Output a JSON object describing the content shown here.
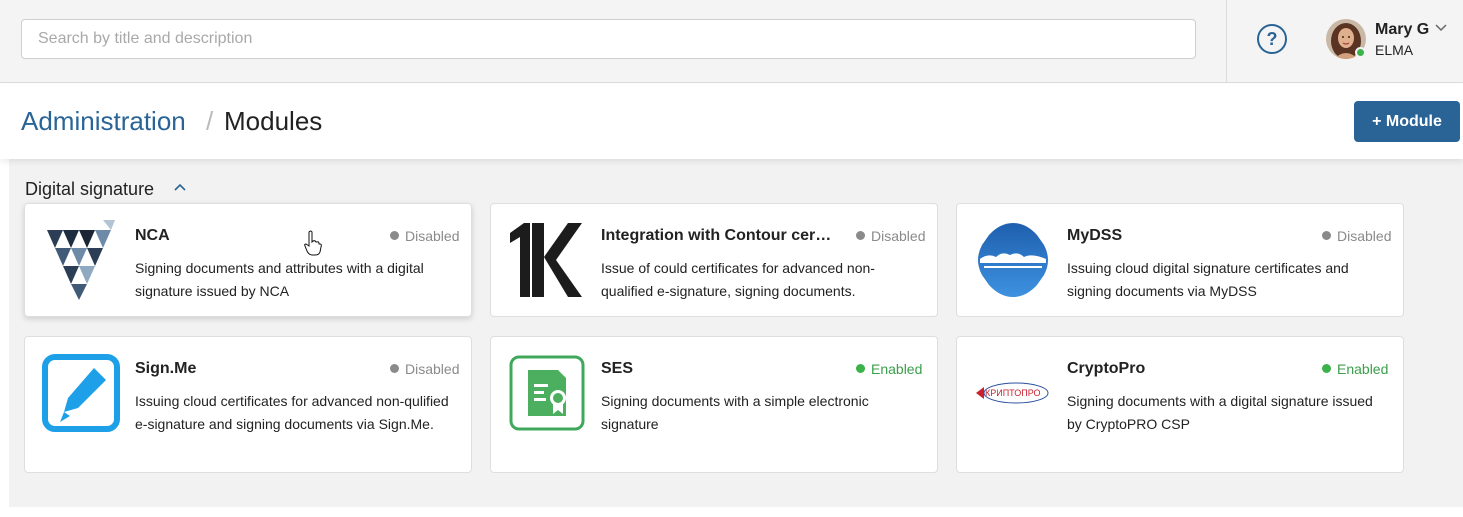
{
  "search": {
    "placeholder": "Search by title and description",
    "value": ""
  },
  "header_icons": {
    "help": "help-question-icon"
  },
  "user": {
    "name": "Mary G",
    "org": "ELMA",
    "online_status": "online"
  },
  "breadcrumb": {
    "parent": "Administration",
    "separator": "/",
    "current": "Modules"
  },
  "add_module_label": "+ Module",
  "section": {
    "title": "Digital signature",
    "expanded": true
  },
  "colors": {
    "accent": "#2a6496",
    "enabled": "#3cb24a",
    "disabled": "#8a8a8a"
  },
  "modules": [
    {
      "title": "NCA",
      "status": "Disabled",
      "state": "disabled",
      "description": "Signing documents and attributes with a digital signature issued by NCA",
      "icon": "nca-logo"
    },
    {
      "title": "Integration with Contour certificates",
      "status": "Disabled",
      "state": "disabled",
      "description": "Issue of could certificates for advanced non-qualified e-signature, signing documents.",
      "icon": "contour-k-logo"
    },
    {
      "title": "MyDSS",
      "status": "Disabled",
      "state": "disabled",
      "description": "Issuing cloud digital signature certificates and signing documents via MyDSS",
      "icon": "mydss-cloud-logo"
    },
    {
      "title": "Sign.Me",
      "status": "Disabled",
      "state": "disabled",
      "description": "Issuing cloud certificates for advanced non-qulified e-signature and signing documents via Sign.Me.",
      "icon": "signme-pen-logo"
    },
    {
      "title": "SES",
      "status": "Enabled",
      "state": "enabled",
      "description": "Signing documents with a simple electronic signature",
      "icon": "ses-certificate-logo"
    },
    {
      "title": "CryptoPro",
      "status": "Enabled",
      "state": "enabled",
      "description": "Signing documents with a digital signature issued by CryptoPRO CSP",
      "icon": "cryptopro-logo",
      "logo_text": "КРИПТОПРО"
    }
  ]
}
